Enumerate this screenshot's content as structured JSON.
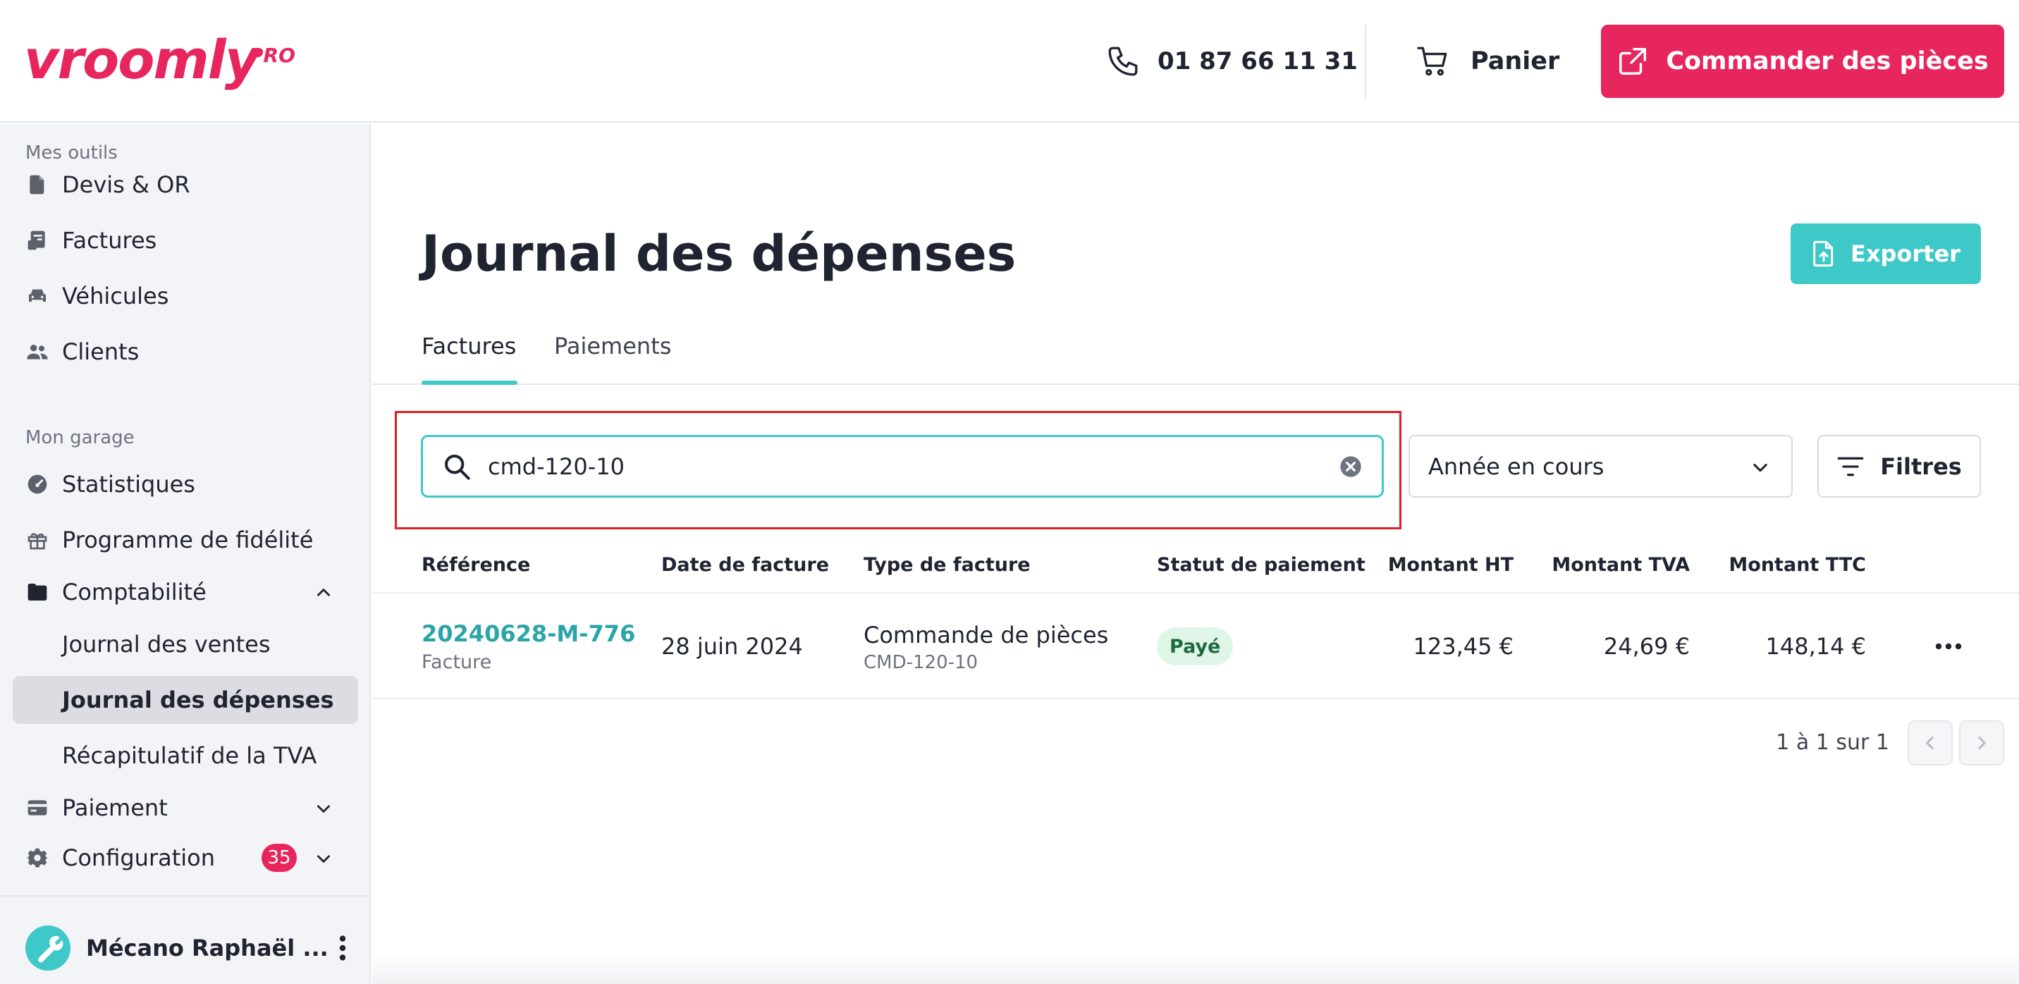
{
  "header": {
    "logo": "vroomly",
    "logo_suffix": "PRO",
    "phone": "01 87 66 11 31",
    "cart_label": "Panier",
    "order_button": "Commander des pièces",
    "brand_color": "#e8265e"
  },
  "sidebar": {
    "section_tools": "Mes outils",
    "tools": [
      {
        "label": "Devis & OR",
        "icon": "document-icon"
      },
      {
        "label": "Factures",
        "icon": "invoice-icon"
      },
      {
        "label": "Véhicules",
        "icon": "car-icon"
      },
      {
        "label": "Clients",
        "icon": "users-icon"
      }
    ],
    "section_garage": "Mon garage",
    "garage": [
      {
        "label": "Statistiques",
        "icon": "gauge-icon"
      },
      {
        "label": "Programme de fidélité",
        "icon": "gift-icon"
      },
      {
        "label": "Comptabilité",
        "icon": "folder-icon",
        "expanded": true
      },
      {
        "label": "Journal des ventes"
      },
      {
        "label": "Journal des dépenses",
        "active": true
      },
      {
        "label": "Récapitulatif de la TVA"
      },
      {
        "label": "Paiement",
        "icon": "card-icon"
      },
      {
        "label": "Configuration",
        "icon": "gear-icon",
        "badge": "35"
      }
    ],
    "user_name": "Mécano Raphaël ..."
  },
  "main": {
    "title": "Journal des dépenses",
    "export_button": "Exporter",
    "tabs": [
      {
        "label": "Factures",
        "active": true
      },
      {
        "label": "Paiements",
        "active": false
      }
    ],
    "search_value": "cmd-120-10",
    "year_select": "Année en cours",
    "filters_button": "Filtres",
    "columns": [
      "Référence",
      "Date de facture",
      "Type de facture",
      "Statut de paiement",
      "Montant HT",
      "Montant TVA",
      "Montant TTC"
    ],
    "rows": [
      {
        "reference": "20240628-M-776",
        "reference_sub": "Facture",
        "date": "28 juin 2024",
        "type": "Commande de pièces",
        "type_sub": "CMD-120-10",
        "status": "Payé",
        "ht": "123,45 €",
        "tva": "24,69 €",
        "ttc": "148,14 €"
      }
    ],
    "pagination": "1 à 1 sur 1",
    "accent_color": "#3ec8c8"
  }
}
